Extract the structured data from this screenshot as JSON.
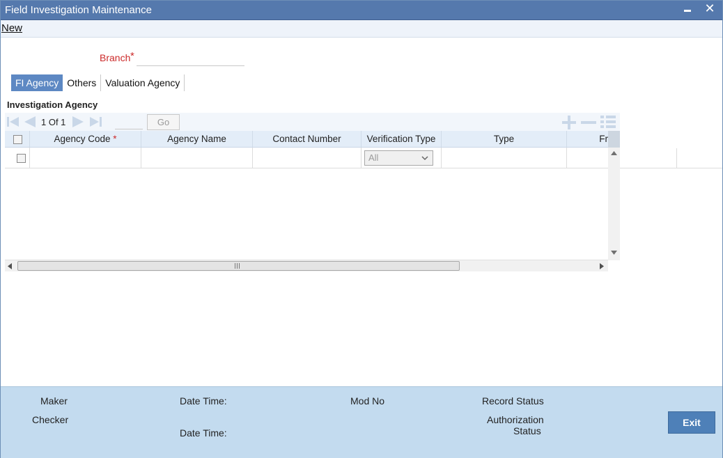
{
  "window": {
    "title": "Field Investigation Maintenance",
    "close_glyph": "✕"
  },
  "menu": {
    "new_label": "New"
  },
  "branch": {
    "label": "Branch",
    "required_mark": "*",
    "value": ""
  },
  "tabs": [
    {
      "label": "FI Agency",
      "active": true
    },
    {
      "label": "Others",
      "active": false
    },
    {
      "label": "Valuation Agency",
      "active": false
    }
  ],
  "section": {
    "title": "Investigation Agency"
  },
  "pager": {
    "text": "1 Of 1",
    "page_input": "",
    "go_label": "Go"
  },
  "grid": {
    "columns": [
      {
        "key": "agency_code",
        "label": "Agency Code",
        "required": true
      },
      {
        "key": "agency_name",
        "label": "Agency Name",
        "required": false
      },
      {
        "key": "contact_number",
        "label": "Contact Number",
        "required": false
      },
      {
        "key": "verification_type",
        "label": "Verification Type",
        "required": false
      },
      {
        "key": "type",
        "label": "Type",
        "required": false
      },
      {
        "key": "fr",
        "label": "Fr",
        "required": false
      }
    ],
    "required_mark": "*",
    "rows": [
      {
        "agency_code": "",
        "agency_name": "",
        "contact_number": "",
        "verification_type": "All",
        "type": ""
      }
    ]
  },
  "footer": {
    "maker_label": "Maker",
    "checker_label": "Checker",
    "date_time_label_1": "Date Time:",
    "date_time_label_2": "Date Time:",
    "mod_no_label": "Mod No",
    "record_status_label": "Record Status",
    "authorization_label": "Authorization",
    "authorization_status_label": "Status",
    "exit_label": "Exit"
  },
  "colors": {
    "titlebar": "#5579ad",
    "active_tab": "#5d88c3",
    "footer": "#c3dbef",
    "exit_button": "#4e80b8",
    "required": "#cc2a2a"
  }
}
